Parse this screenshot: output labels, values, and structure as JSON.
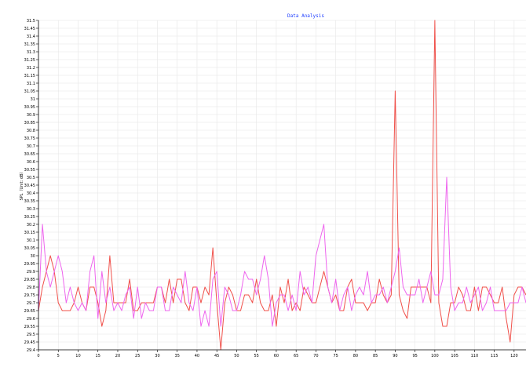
{
  "chart_data": {
    "type": "line",
    "title": "Data Analysis",
    "xlabel": "",
    "ylabel": "SPL（Unit: dB）",
    "xlim": [
      0,
      123
    ],
    "ylim": [
      29.4,
      31.5
    ],
    "grid": true,
    "x_ticks": [
      0,
      5,
      10,
      15,
      20,
      25,
      30,
      35,
      40,
      45,
      50,
      55,
      60,
      65,
      70,
      75,
      80,
      85,
      90,
      95,
      100,
      105,
      110,
      115,
      120
    ],
    "x_tick_labels": [
      "0",
      "5",
      "10",
      "15",
      "20",
      "25",
      "30",
      "35",
      "40",
      "45",
      "50",
      "55",
      "60",
      "65",
      "70",
      "75",
      "80",
      "85",
      "90",
      "95",
      "100",
      "105",
      "110",
      "115",
      "120"
    ],
    "y_tick_labels": [
      "29.4",
      "29.45",
      "29.5",
      "29.55",
      "29.6",
      "29.65",
      "29.7",
      "29.75",
      "29.8",
      "29.85",
      "29.9",
      "29.95",
      "30",
      "30.05",
      "30.1",
      "30.15",
      "30.2",
      "30.25",
      "30.3",
      "30.35",
      "30.4",
      "30.45",
      "30.5",
      "30.55",
      "30.6",
      "30.65",
      "30.7",
      "30.75",
      "30.8",
      "30.85",
      "30.9",
      "30.95",
      "31",
      "31.05",
      "31.1",
      "31.15",
      "31.2",
      "31.25",
      "31.3",
      "31.35",
      "31.4",
      "31.45",
      "31.5"
    ],
    "series": [
      {
        "color": "#f0504a",
        "x": [
          0,
          1,
          2,
          3,
          4,
          5,
          6,
          7,
          8,
          9,
          10,
          11,
          12,
          13,
          14,
          15,
          16,
          17,
          18,
          19,
          20,
          21,
          22,
          23,
          24,
          25,
          26,
          27,
          28,
          29,
          30,
          31,
          32,
          33,
          34,
          35,
          36,
          37,
          38,
          39,
          40,
          41,
          42,
          43,
          44,
          45,
          46,
          47,
          48,
          49,
          50,
          51,
          52,
          53,
          54,
          55,
          56,
          57,
          58,
          59,
          60,
          61,
          62,
          63,
          64,
          65,
          66,
          67,
          68,
          69,
          70,
          71,
          72,
          73,
          74,
          75,
          76,
          77,
          78,
          79,
          80,
          81,
          82,
          83,
          84,
          85,
          86,
          87,
          88,
          89,
          90,
          91,
          92,
          93,
          94,
          95,
          96,
          97,
          98,
          99,
          100,
          101,
          102,
          103,
          104,
          105,
          106,
          107,
          108,
          109,
          110,
          111,
          112,
          113,
          114,
          115,
          116,
          117,
          118,
          119,
          120,
          121,
          122,
          123
        ],
        "values": [
          29.65,
          29.8,
          29.9,
          30.0,
          29.9,
          29.7,
          29.65,
          29.65,
          29.65,
          29.7,
          29.8,
          29.7,
          29.65,
          29.8,
          29.8,
          29.7,
          29.55,
          29.65,
          30.0,
          29.7,
          29.7,
          29.7,
          29.7,
          29.85,
          29.65,
          29.65,
          29.7,
          29.7,
          29.7,
          29.7,
          29.8,
          29.8,
          29.7,
          29.85,
          29.7,
          29.85,
          29.85,
          29.7,
          29.65,
          29.8,
          29.8,
          29.7,
          29.8,
          29.75,
          30.05,
          29.7,
          29.4,
          29.7,
          29.8,
          29.75,
          29.65,
          29.65,
          29.75,
          29.75,
          29.7,
          29.85,
          29.7,
          29.65,
          29.65,
          29.75,
          29.55,
          29.8,
          29.7,
          29.85,
          29.65,
          29.7,
          29.65,
          29.8,
          29.75,
          29.7,
          29.7,
          29.8,
          29.9,
          29.8,
          29.7,
          29.75,
          29.65,
          29.65,
          29.8,
          29.85,
          29.7,
          29.7,
          29.7,
          29.65,
          29.7,
          29.7,
          29.85,
          29.75,
          29.7,
          29.75,
          31.05,
          29.75,
          29.65,
          29.6,
          29.8,
          29.8,
          29.8,
          29.8,
          29.8,
          29.7,
          31.5,
          29.7,
          29.55,
          29.55,
          29.7,
          29.7,
          29.8,
          29.75,
          29.65,
          29.65,
          29.8,
          29.65,
          29.8,
          29.8,
          29.75,
          29.7,
          29.7,
          29.8,
          29.6,
          29.45,
          29.75,
          29.8,
          29.8,
          29.75
        ]
      },
      {
        "color": "#ee66ee",
        "x": [
          0,
          1,
          2,
          3,
          4,
          5,
          6,
          7,
          8,
          9,
          10,
          11,
          12,
          13,
          14,
          15,
          16,
          17,
          18,
          19,
          20,
          21,
          22,
          23,
          24,
          25,
          26,
          27,
          28,
          29,
          30,
          31,
          32,
          33,
          34,
          35,
          36,
          37,
          38,
          39,
          40,
          41,
          42,
          43,
          44,
          45,
          46,
          47,
          48,
          49,
          50,
          51,
          52,
          53,
          54,
          55,
          56,
          57,
          58,
          59,
          60,
          61,
          62,
          63,
          64,
          65,
          66,
          67,
          68,
          69,
          70,
          71,
          72,
          73,
          74,
          75,
          76,
          77,
          78,
          79,
          80,
          81,
          82,
          83,
          84,
          85,
          86,
          87,
          88,
          89,
          90,
          91,
          92,
          93,
          94,
          95,
          96,
          97,
          98,
          99,
          100,
          101,
          102,
          103,
          104,
          105,
          106,
          107,
          108,
          109,
          110,
          111,
          112,
          113,
          114,
          115,
          116,
          117,
          118,
          119,
          120,
          121,
          122,
          123
        ],
        "values": [
          29.65,
          30.2,
          29.9,
          29.8,
          29.9,
          30.0,
          29.9,
          29.7,
          29.8,
          29.7,
          29.65,
          29.7,
          29.65,
          29.9,
          30.0,
          29.6,
          29.9,
          29.7,
          29.8,
          29.65,
          29.7,
          29.65,
          29.75,
          29.8,
          29.6,
          29.8,
          29.6,
          29.7,
          29.65,
          29.65,
          29.8,
          29.8,
          29.65,
          29.65,
          29.8,
          29.75,
          29.7,
          29.9,
          29.7,
          29.65,
          29.8,
          29.55,
          29.65,
          29.55,
          29.85,
          29.9,
          29.55,
          29.8,
          29.75,
          29.65,
          29.65,
          29.75,
          29.9,
          29.85,
          29.85,
          29.75,
          29.85,
          30.0,
          29.85,
          29.55,
          29.7,
          29.75,
          29.75,
          29.65,
          29.75,
          29.65,
          29.9,
          29.75,
          29.8,
          29.7,
          30.0,
          30.1,
          30.2,
          29.8,
          29.7,
          29.85,
          29.65,
          29.75,
          29.8,
          29.65,
          29.75,
          29.8,
          29.75,
          29.9,
          29.7,
          29.75,
          29.75,
          29.8,
          29.7,
          29.8,
          29.9,
          30.05,
          29.8,
          29.75,
          29.75,
          29.75,
          29.85,
          29.7,
          29.8,
          29.9,
          29.75,
          29.75,
          29.85,
          30.5,
          29.8,
          29.65,
          29.7,
          29.7,
          29.8,
          29.7,
          29.75,
          29.8,
          29.65,
          29.7,
          29.8,
          29.65,
          29.65,
          29.65,
          29.65,
          29.7,
          29.7,
          29.7,
          29.8,
          29.7
        ]
      }
    ]
  }
}
